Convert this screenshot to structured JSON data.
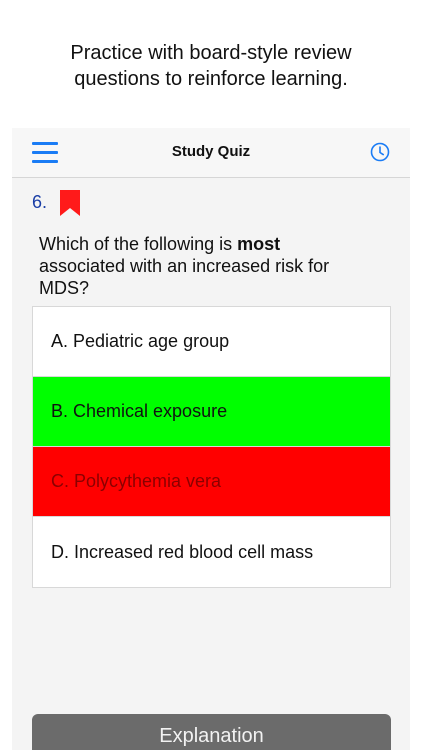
{
  "caption": {
    "line1": "Practice with board-style review",
    "line2": "questions to reinforce learning."
  },
  "navbar": {
    "title": "Study Quiz",
    "menu_icon": "hamburger-menu-icon",
    "clock_icon": "clock-icon"
  },
  "question": {
    "number": "6.",
    "bookmarked": true,
    "text_before": "Which of the following is ",
    "text_bold": "most",
    "text_after": " associated with an increased risk for MDS?"
  },
  "answers": [
    {
      "label": "A. Pediatric age group",
      "state": "neutral"
    },
    {
      "label": "B. Chemical exposure",
      "state": "correct"
    },
    {
      "label": "C. Polycythemia vera",
      "state": "incorrect"
    },
    {
      "label": "D. Increased red blood cell mass",
      "state": "neutral"
    }
  ],
  "explanation_button": {
    "label": "Explanation"
  },
  "colors": {
    "accent": "#1a7cf5",
    "correct": "#00ff00",
    "incorrect": "#ff0000",
    "bookmark": "#ff1a1a",
    "button": "#6b6b6b"
  }
}
